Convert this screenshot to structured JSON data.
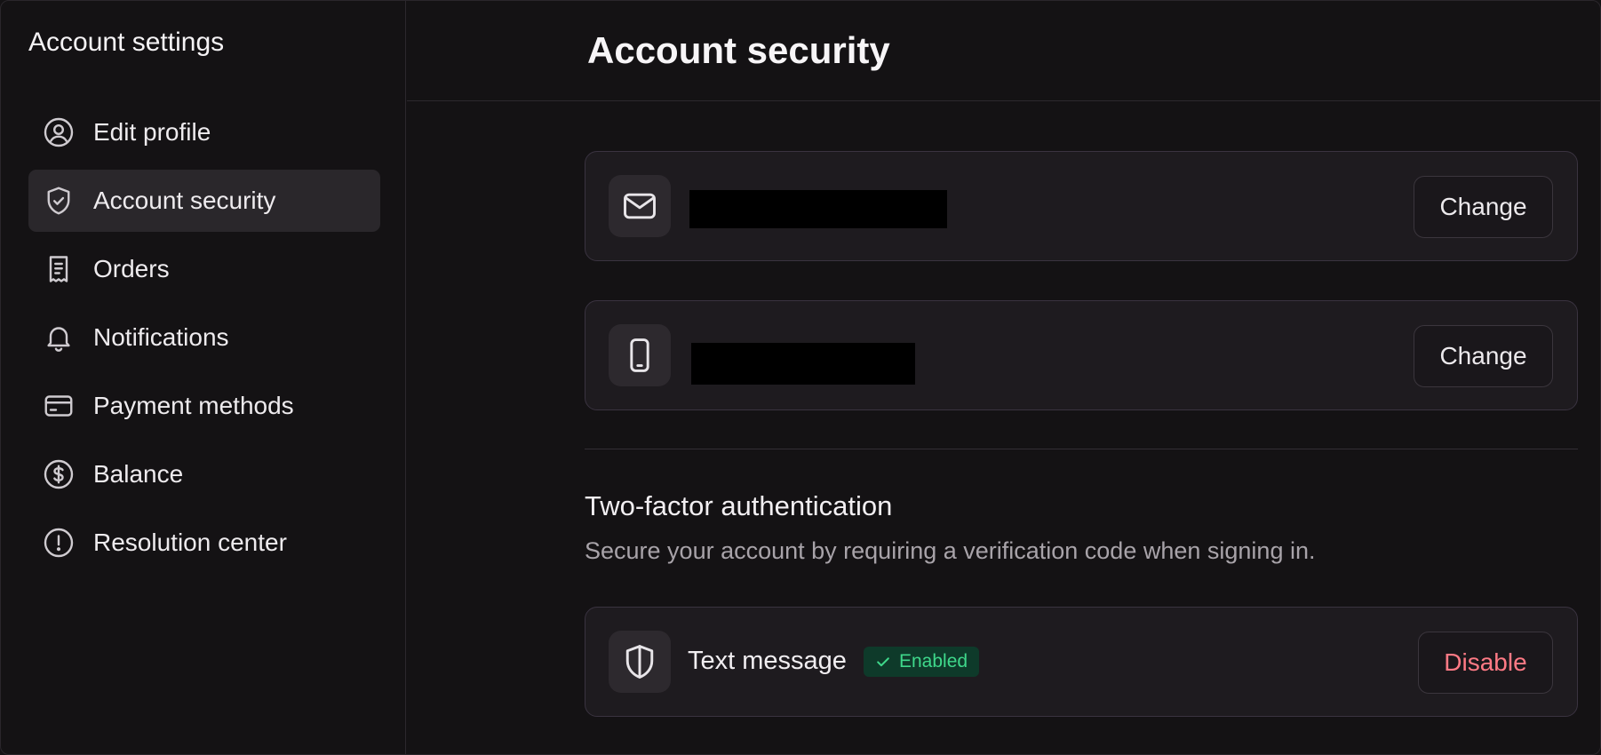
{
  "sidebar": {
    "title": "Account settings",
    "items": [
      {
        "label": "Edit profile",
        "icon": "user-circle-icon",
        "active": false
      },
      {
        "label": "Account security",
        "icon": "shield-check-icon",
        "active": true
      },
      {
        "label": "Orders",
        "icon": "receipt-icon",
        "active": false
      },
      {
        "label": "Notifications",
        "icon": "bell-icon",
        "active": false
      },
      {
        "label": "Payment methods",
        "icon": "credit-card-icon",
        "active": false
      },
      {
        "label": "Balance",
        "icon": "dollar-circle-icon",
        "active": false
      },
      {
        "label": "Resolution center",
        "icon": "alert-circle-icon",
        "active": false
      }
    ]
  },
  "main": {
    "title": "Account security",
    "email_card": {
      "icon": "mail-icon",
      "button_label": "Change"
    },
    "phone_card": {
      "icon": "smartphone-icon",
      "button_label": "Change"
    },
    "two_factor": {
      "title": "Two-factor authentication",
      "description": "Secure your account by requiring a verification code when signing in.",
      "method": {
        "icon": "shield-icon",
        "label": "Text message",
        "status": "Enabled",
        "button_label": "Disable"
      }
    }
  },
  "colors": {
    "background": "#141214",
    "card": "#1e1b1f",
    "active_nav": "#2a272b",
    "badge_bg": "#0e3a2a",
    "badge_text": "#3fd88b",
    "danger": "#ff7a85"
  }
}
